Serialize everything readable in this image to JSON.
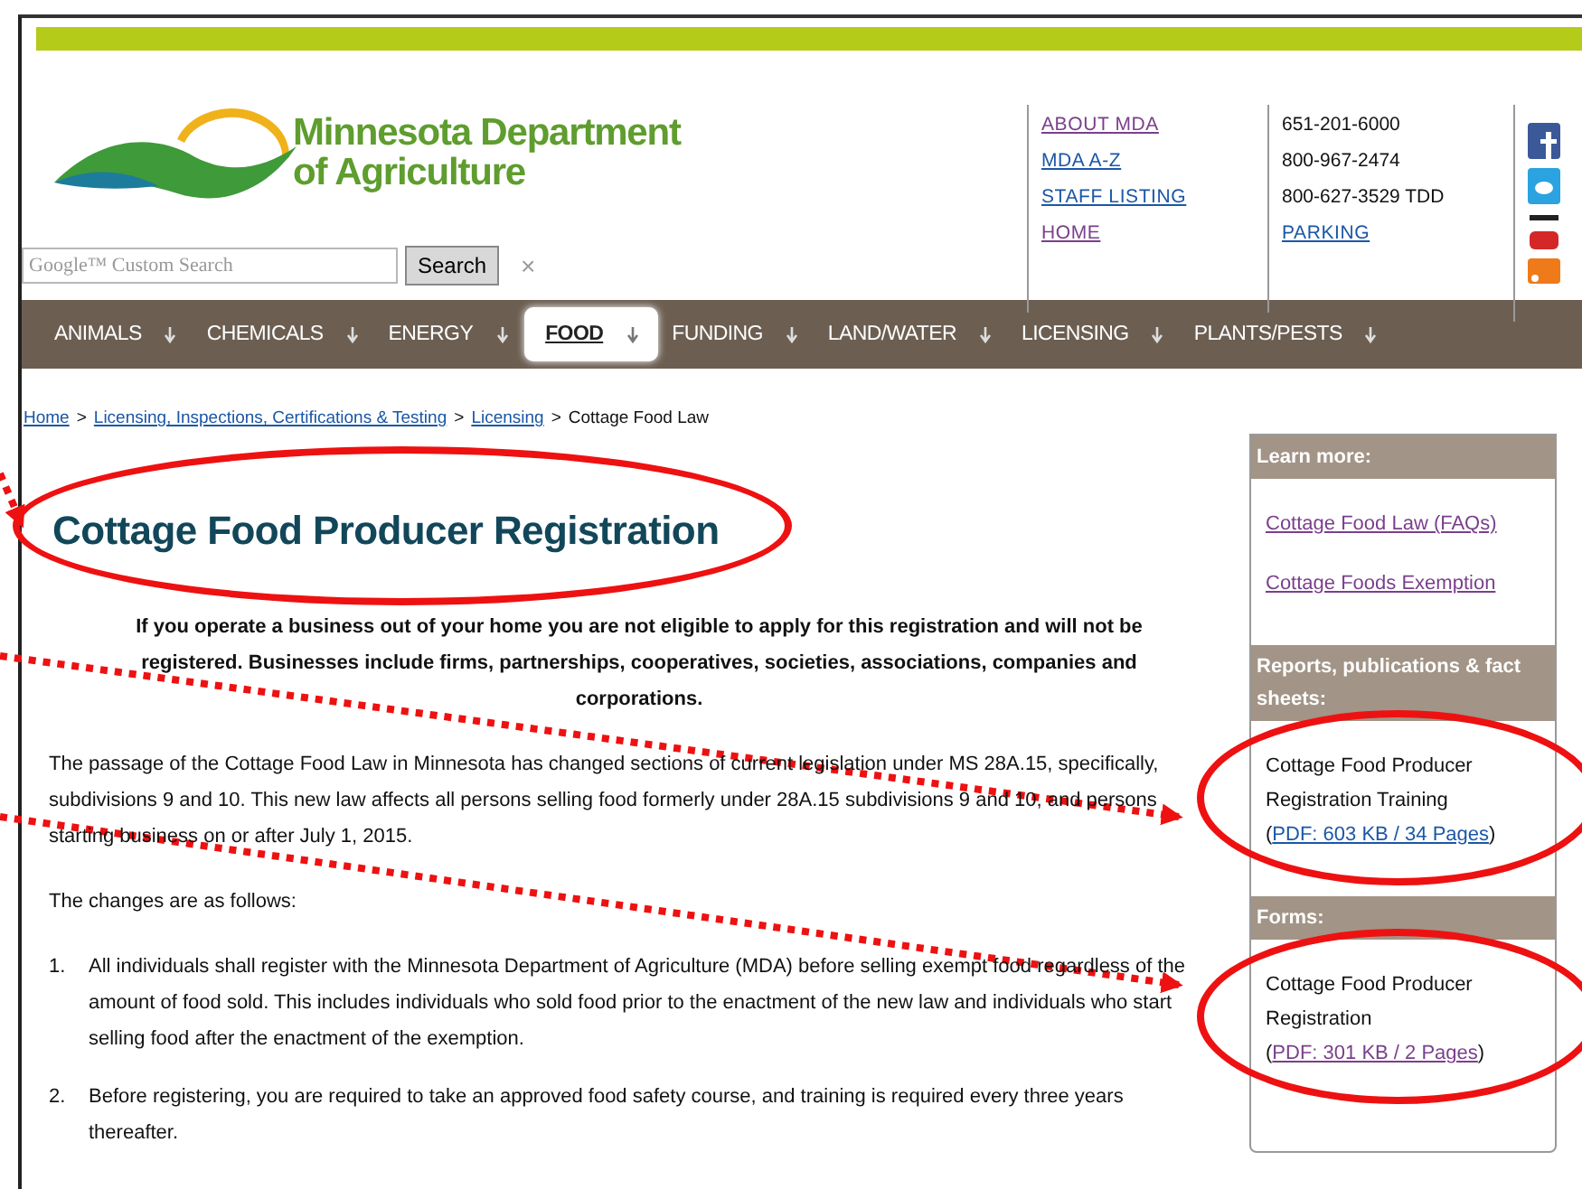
{
  "logo": {
    "lines": [
      "Minnesota Department",
      "of Agriculture"
    ]
  },
  "search": {
    "placeholder": "Google™ Custom Search",
    "button": "Search",
    "clear": "×"
  },
  "top_links": [
    {
      "label": "ABOUT MDA",
      "visited": true
    },
    {
      "label": "MDA A-Z",
      "visited": false
    },
    {
      "label": "STAFF LISTING",
      "visited": false
    },
    {
      "label": "HOME",
      "visited": true
    }
  ],
  "contact": [
    {
      "kind": "text",
      "text": "651-201-6000"
    },
    {
      "kind": "text",
      "text": "800-967-2474"
    },
    {
      "kind": "text",
      "text": "800-627-3529 TDD"
    },
    {
      "kind": "link",
      "text": "PARKING"
    }
  ],
  "nav": [
    {
      "label": "ANIMALS",
      "selected": false
    },
    {
      "label": "CHEMICALS",
      "selected": false
    },
    {
      "label": "ENERGY",
      "selected": false
    },
    {
      "label": "FOOD",
      "selected": true
    },
    {
      "label": "FUNDING",
      "selected": false
    },
    {
      "label": "LAND/WATER",
      "selected": false
    },
    {
      "label": "LICENSING",
      "selected": false
    },
    {
      "label": "PLANTS/PESTS",
      "selected": false
    }
  ],
  "breadcrumb": {
    "links": [
      "Home",
      "Licensing, Inspections, Certifications & Testing",
      "Licensing"
    ],
    "separator": ">",
    "current": "Cottage Food Law"
  },
  "title": {
    "text": "Cottage Food Producer Registration",
    "highlighted": true
  },
  "notice": "If you operate a business out of your home you are not eligible to apply for this registration and will not be registered. Businesses include firms, partnerships, cooperatives, societies, associations, companies and corporations.",
  "paragraphs": [
    "The passage of the Cottage Food Law in Minnesota has changed sections of current legislation under MS 28A.15, specifically, subdivisions 9 and 10. This new law affects all persons selling food formerly under 28A.15 subdivisions 9 and 10, and persons starting business on or after July 1, 2015.",
    "The changes are as follows:"
  ],
  "changes": [
    {
      "number": "1.",
      "text": "All individuals shall register with the Minnesota Department of Agriculture (MDA) before selling exempt food regardless of the amount of food sold. This includes individuals who sold food prior to the enactment of the new law and individuals who start selling food after the enactment of the exemption."
    },
    {
      "number": "2.",
      "text": "Before registering, you are required to take an approved food safety course, and training is required every three years thereafter."
    }
  ],
  "sidebar": [
    {
      "heading": "Learn more:",
      "items": [
        {
          "kind": "link",
          "text": "Cottage Food Law (FAQs)",
          "visited": true
        },
        {
          "kind": "link",
          "text": "Cottage Foods Exemption",
          "visited": true
        }
      ]
    },
    {
      "heading": "Reports, publications & fact sheets:",
      "items": [
        {
          "kind": "document",
          "before": "Cottage Food Producer Registration Training (",
          "link": "PDF: 603 KB / 34 Pages",
          "after": ")",
          "visited": false,
          "highlighted": true
        }
      ]
    },
    {
      "heading": "Forms:",
      "items": [
        {
          "kind": "document",
          "before": "Cottage Food Producer Registration (",
          "link": "PDF: 301 KB / 2 Pages",
          "after": ")",
          "visited": true,
          "highlighted": true
        }
      ]
    }
  ],
  "annotation_arrows": true
}
